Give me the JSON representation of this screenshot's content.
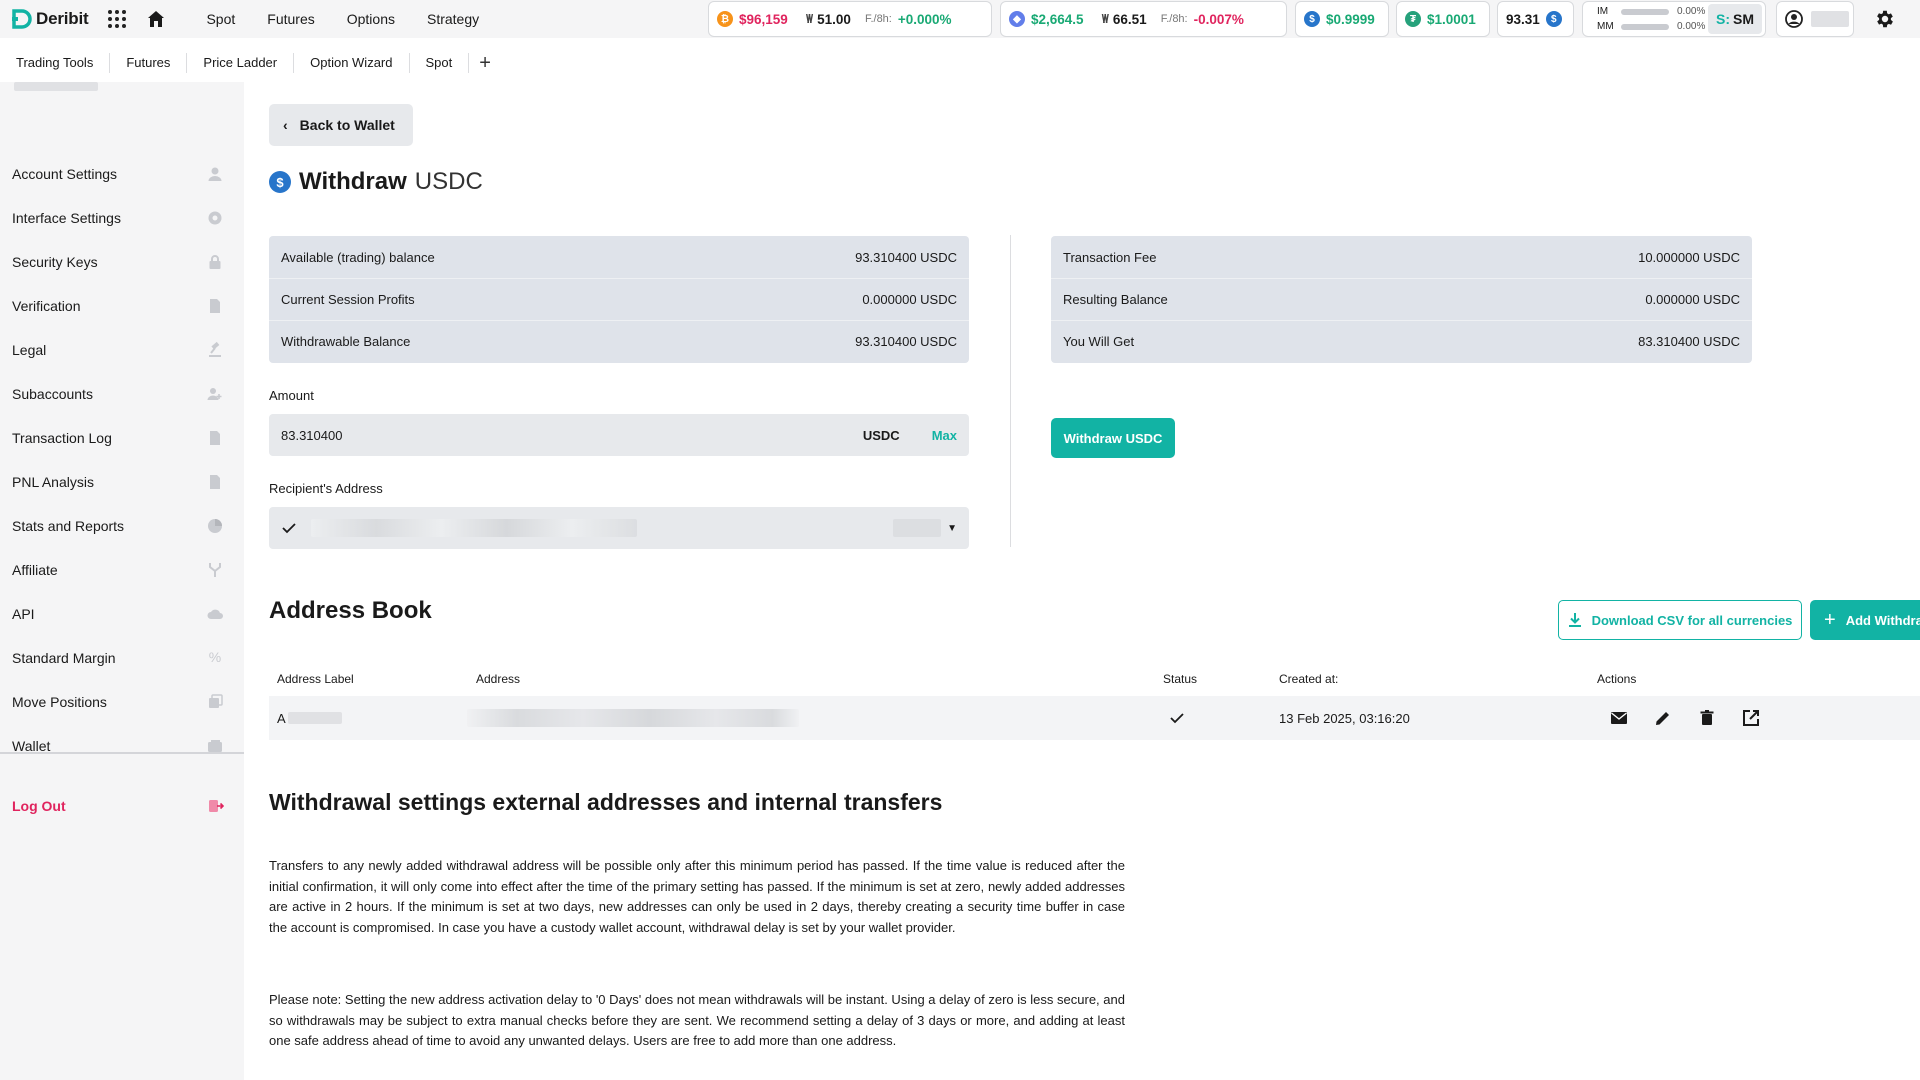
{
  "app": {
    "brand": "Deribit"
  },
  "topnav": [
    "Spot",
    "Futures",
    "Options",
    "Strategy"
  ],
  "tickers": {
    "btc": {
      "price": "$96,159",
      "dvol": "51.00",
      "funding_label": "F./8h:",
      "funding": "+0.000%"
    },
    "eth": {
      "price": "$2,664.5",
      "dvol": "66.51",
      "funding_label": "F./8h:",
      "funding": "-0.007%"
    },
    "usdc": {
      "price": "$0.9999"
    },
    "usdt": {
      "price": "$1.0001"
    },
    "balance": {
      "value": "93.31"
    }
  },
  "margin": {
    "im_label": "IM",
    "mm_label": "MM",
    "im_pct": "0.00%",
    "mm_pct": "0.00%",
    "im_fraction": 0,
    "mm_fraction": 0
  },
  "account_badge": {
    "prefix": "S:",
    "initials": "SM"
  },
  "tabs": [
    "Trading Tools",
    "Futures",
    "Price Ladder",
    "Option Wizard",
    "Spot"
  ],
  "sidebar": {
    "items": [
      {
        "label": "Account Settings",
        "icon": "person-icon"
      },
      {
        "label": "Interface Settings",
        "icon": "gear-icon"
      },
      {
        "label": "Security Keys",
        "icon": "lock-icon"
      },
      {
        "label": "Verification",
        "icon": "document-icon"
      },
      {
        "label": "Legal",
        "icon": "gavel-icon"
      },
      {
        "label": "Subaccounts",
        "icon": "people-icon"
      },
      {
        "label": "Transaction Log",
        "icon": "file-icon"
      },
      {
        "label": "PNL Analysis",
        "icon": "file-icon"
      },
      {
        "label": "Stats and Reports",
        "icon": "pie-icon"
      },
      {
        "label": "Affiliate",
        "icon": "fork-icon"
      },
      {
        "label": "API",
        "icon": "cloud-icon"
      },
      {
        "label": "Standard Margin",
        "icon": "percent-icon"
      },
      {
        "label": "Move Positions",
        "icon": "copy-icon"
      },
      {
        "label": "Wallet",
        "icon": "wallet-icon"
      }
    ],
    "logout": "Log Out"
  },
  "page": {
    "back_label": "Back to Wallet",
    "title": "Withdraw",
    "currency": "USDC"
  },
  "balances": [
    {
      "label": "Available (trading) balance",
      "value": "93.310400 USDC"
    },
    {
      "label": "Current Session Profits",
      "value": "0.000000 USDC"
    },
    {
      "label": "Withdrawable Balance",
      "value": "93.310400 USDC"
    }
  ],
  "fees": [
    {
      "label": "Transaction Fee",
      "value": "10.000000 USDC"
    },
    {
      "label": "Resulting Balance",
      "value": "0.000000 USDC"
    },
    {
      "label": "You Will Get",
      "value": "83.310400 USDC"
    }
  ],
  "amount": {
    "label": "Amount",
    "value": "83.310400",
    "currency": "USDC",
    "max_label": "Max"
  },
  "recipient": {
    "label": "Recipient's Address"
  },
  "withdraw_button": "Withdraw USDC",
  "address_book": {
    "title": "Address Book",
    "csv_button": "Download CSV for all currencies",
    "add_button": "Add Withdra",
    "columns": [
      "Address Label",
      "Address",
      "Status",
      "Created at:",
      "Actions"
    ],
    "rows": [
      {
        "label_initial": "A",
        "created": "13 Feb 2025, 03:16:20"
      }
    ]
  },
  "settings": {
    "title": "Withdrawal settings external addresses and internal transfers",
    "para1": "Transfers to any newly added withdrawal address will be possible only after this minimum period has passed. If the time value is reduced after the initial confirmation, it will only come into effect after the time of the primary setting has passed. If the minimum is set at zero, newly added addresses are active in 2 hours. If the minimum is set at two days, new addresses can only be used in 2 days, thereby creating a security time buffer in case the account is compromised. In case you have a custody wallet account, withdrawal delay is set by your wallet provider.",
    "para2": "Please note: Setting the new address activation delay to '0 Days' does not mean withdrawals will be instant. Using a delay of zero is less secure, and so withdrawals may be subject to extra manual checks before they are sent. We recommend setting a delay of 3 days or more, and adding at least one safe address ahead of time to avoid any unwanted delays. Users are free to add more than one address."
  },
  "colors": {
    "accent": "#12b3a4",
    "danger": "#e0245e",
    "positive": "#19a974",
    "panel": "#dfe3ea"
  }
}
